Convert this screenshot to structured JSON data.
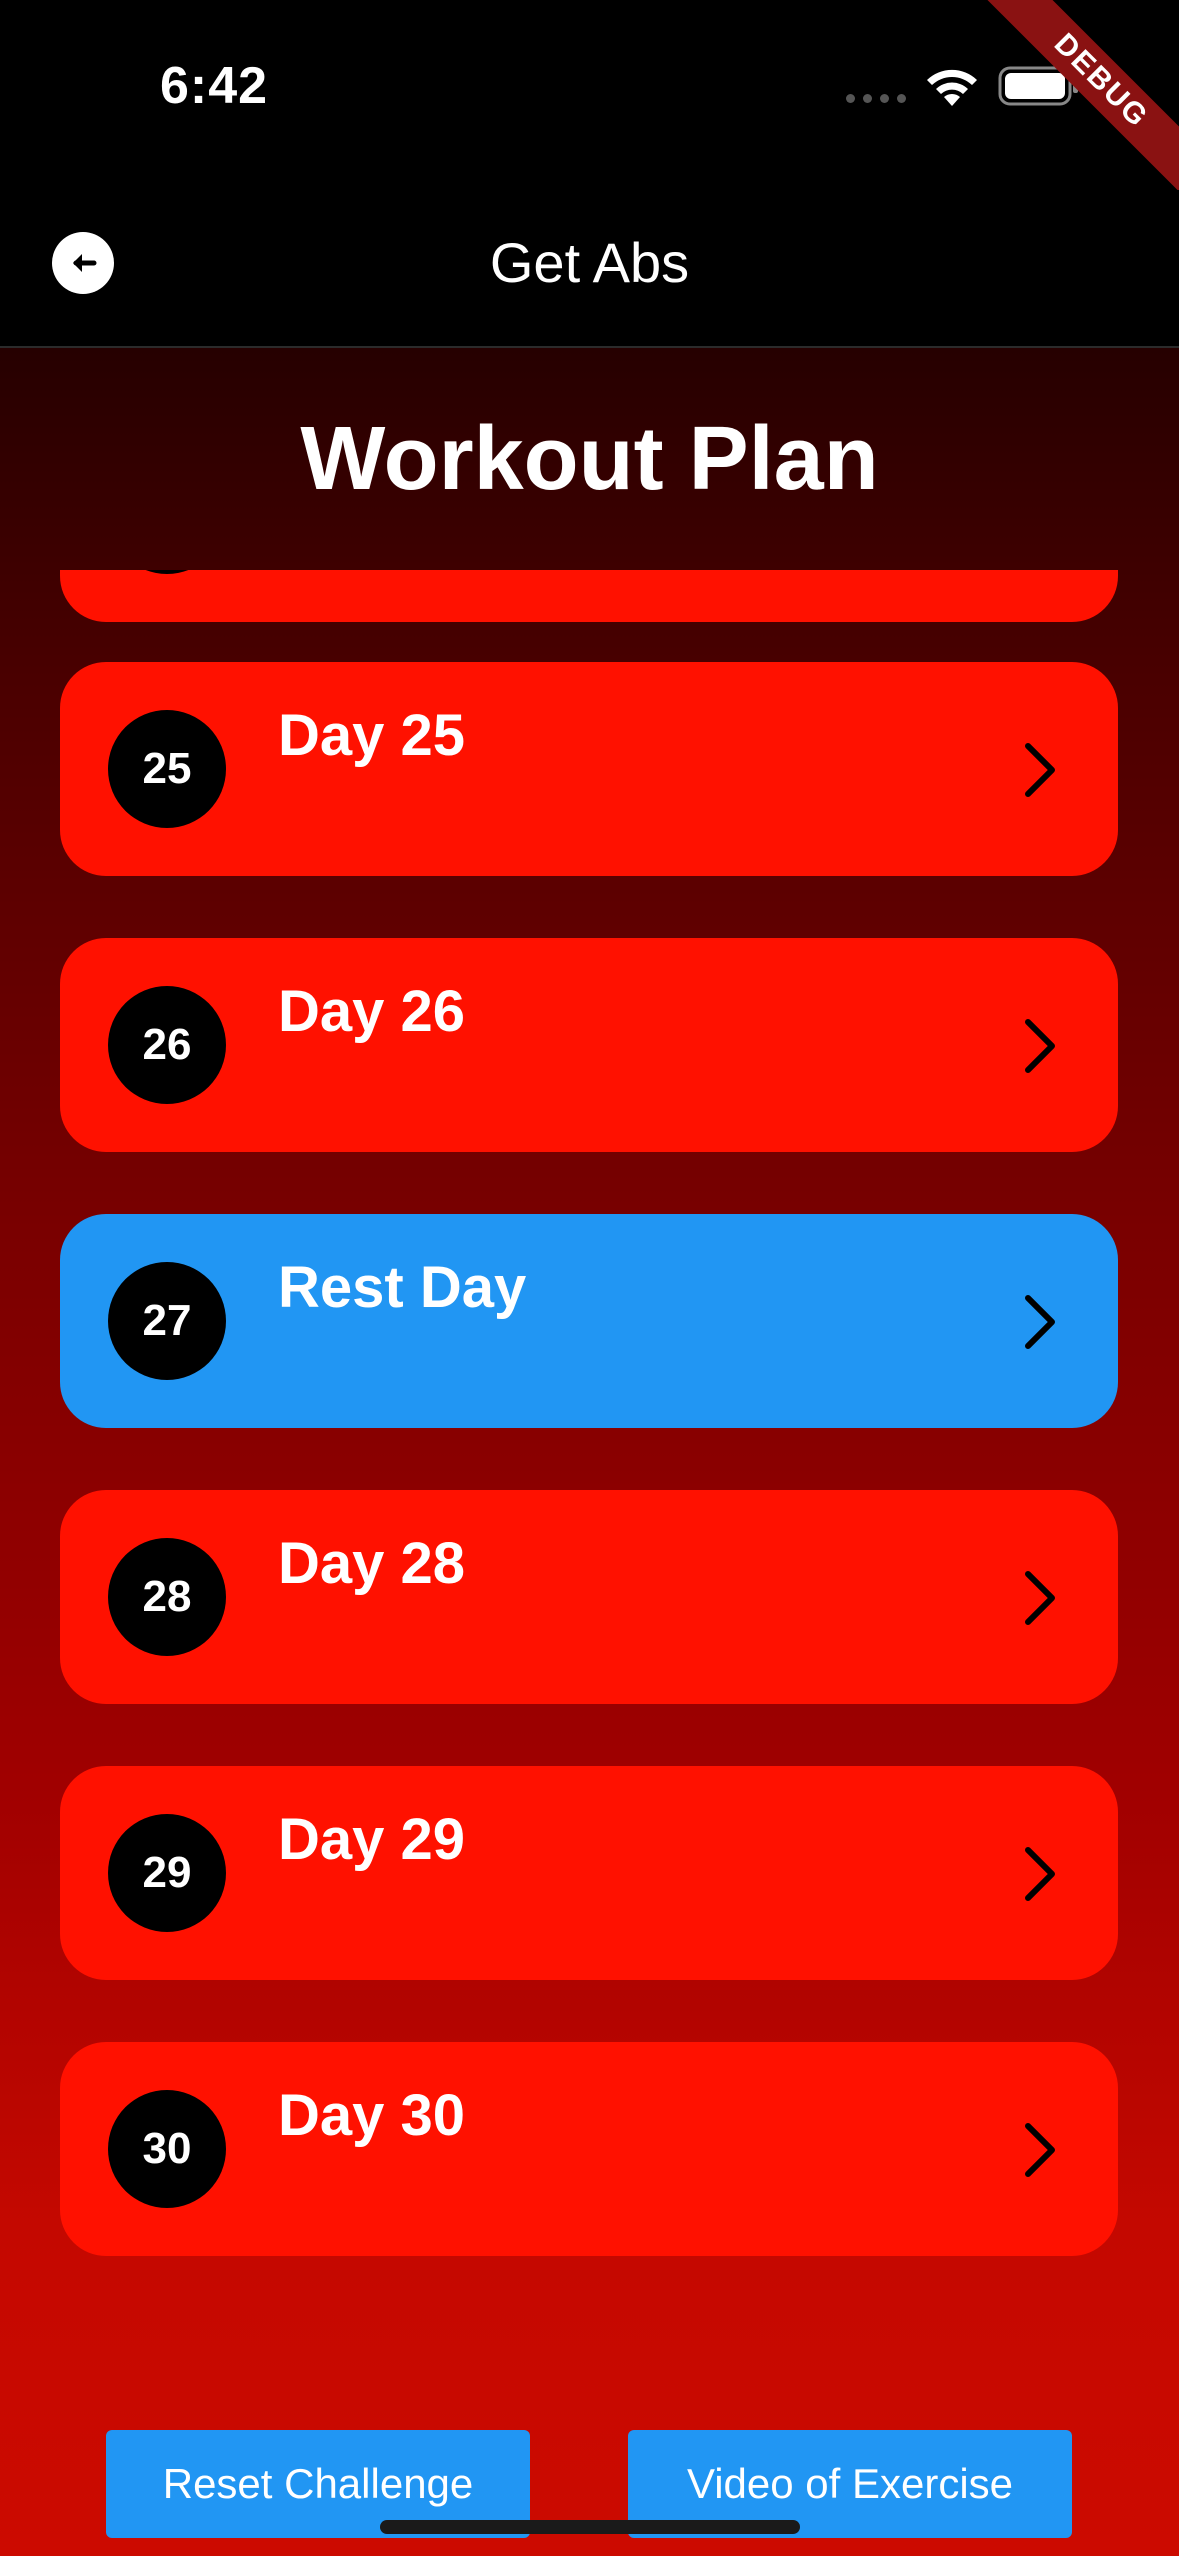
{
  "status_bar": {
    "time": "6:42"
  },
  "debug_banner": "DEBUG",
  "app_bar": {
    "title": "Get Abs",
    "back_icon": "arrow-left-icon"
  },
  "page": {
    "heading": "Workout Plan"
  },
  "days": [
    {
      "number": "",
      "label": "",
      "type": "workout"
    },
    {
      "number": "25",
      "label": "Day 25",
      "type": "workout"
    },
    {
      "number": "26",
      "label": "Day 26",
      "type": "workout"
    },
    {
      "number": "27",
      "label": "Rest Day",
      "type": "rest"
    },
    {
      "number": "28",
      "label": "Day 28",
      "type": "workout"
    },
    {
      "number": "29",
      "label": "Day 29",
      "type": "workout"
    },
    {
      "number": "30",
      "label": "Day 30",
      "type": "workout"
    }
  ],
  "buttons": {
    "reset": "Reset Challenge",
    "video": "Video of Exercise"
  },
  "colors": {
    "workout_card": "#ff1100",
    "rest_card": "#2196f3",
    "button": "#2196f3"
  }
}
